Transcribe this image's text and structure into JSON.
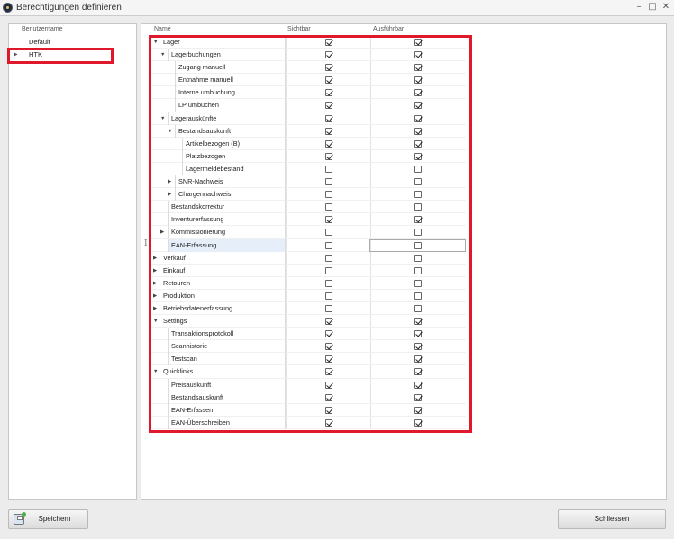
{
  "window": {
    "title": "Berechtigungen definieren",
    "minimize": "–",
    "maximize": "□",
    "close": "✕"
  },
  "users": {
    "header": "Benutzername",
    "items": [
      {
        "label": "Default",
        "has_arrow": false
      },
      {
        "label": "HTK",
        "has_arrow": true
      }
    ]
  },
  "table": {
    "col_name": "Name",
    "col_visible": "Sichtbar",
    "col_exec": "Ausführbar",
    "rows": [
      {
        "label": "Lager",
        "depth": 0,
        "exp": "down",
        "v": true,
        "e": true
      },
      {
        "label": "Lagerbuchungen",
        "depth": 1,
        "exp": "down",
        "v": true,
        "e": true
      },
      {
        "label": "Zugang manuell",
        "depth": 2,
        "exp": "",
        "v": true,
        "e": true
      },
      {
        "label": "Entnahme manuell",
        "depth": 2,
        "exp": "",
        "v": true,
        "e": true
      },
      {
        "label": "Interne umbuchung",
        "depth": 2,
        "exp": "",
        "v": true,
        "e": true
      },
      {
        "label": "LP umbuchen",
        "depth": 2,
        "exp": "",
        "v": true,
        "e": true
      },
      {
        "label": "Lagerauskünfte",
        "depth": 1,
        "exp": "down",
        "v": true,
        "e": true
      },
      {
        "label": "Bestandsauskunft",
        "depth": 2,
        "exp": "down",
        "v": true,
        "e": true
      },
      {
        "label": "Artikelbezogen (B)",
        "depth": 3,
        "exp": "",
        "v": true,
        "e": true
      },
      {
        "label": "Platzbezogen",
        "depth": 3,
        "exp": "",
        "v": true,
        "e": true
      },
      {
        "label": "Lagermeldebestand",
        "depth": 3,
        "exp": "",
        "v": false,
        "e": false
      },
      {
        "label": "SNR-Nachweis",
        "depth": 2,
        "exp": "right",
        "v": false,
        "e": false
      },
      {
        "label": "Chargennachweis",
        "depth": 2,
        "exp": "right",
        "v": false,
        "e": false
      },
      {
        "label": "Bestandskorrektur",
        "depth": 1,
        "exp": "",
        "v": false,
        "e": false
      },
      {
        "label": "Inventurerfassung",
        "depth": 1,
        "exp": "",
        "v": true,
        "e": true
      },
      {
        "label": "Kommissionierung",
        "depth": 1,
        "exp": "right",
        "v": false,
        "e": false
      },
      {
        "label": "EAN-Erfassung",
        "depth": 1,
        "exp": "",
        "v": false,
        "e": false,
        "selected": true
      },
      {
        "label": "Verkauf",
        "depth": 0,
        "exp": "right",
        "v": false,
        "e": false
      },
      {
        "label": "Einkauf",
        "depth": 0,
        "exp": "right",
        "v": false,
        "e": false
      },
      {
        "label": "Retouren",
        "depth": 0,
        "exp": "right",
        "v": false,
        "e": false
      },
      {
        "label": "Produktion",
        "depth": 0,
        "exp": "right",
        "v": false,
        "e": false
      },
      {
        "label": "Betriebsdatenerfassung",
        "depth": 0,
        "exp": "right",
        "v": false,
        "e": false
      },
      {
        "label": "Settings",
        "depth": 0,
        "exp": "down",
        "v": true,
        "e": true
      },
      {
        "label": "Transaktionsprotokoll",
        "depth": 1,
        "exp": "",
        "v": true,
        "e": true
      },
      {
        "label": "Scanhistorie",
        "depth": 1,
        "exp": "",
        "v": true,
        "e": true
      },
      {
        "label": "Testscan",
        "depth": 1,
        "exp": "",
        "v": true,
        "e": true
      },
      {
        "label": "Quicklinks",
        "depth": 0,
        "exp": "down",
        "v": true,
        "e": true
      },
      {
        "label": "Preisauskunft",
        "depth": 1,
        "exp": "",
        "v": true,
        "e": true
      },
      {
        "label": "Bestandsauskunft",
        "depth": 1,
        "exp": "",
        "v": true,
        "e": true
      },
      {
        "label": "EAN-Erfassen",
        "depth": 1,
        "exp": "",
        "v": true,
        "e": true
      },
      {
        "label": "EAN-Überschreiben",
        "depth": 1,
        "exp": "",
        "v": true,
        "e": true
      }
    ]
  },
  "buttons": {
    "save": "Speichern",
    "close": "Schliessen"
  },
  "colors": {
    "highlight": "#e0182b"
  }
}
